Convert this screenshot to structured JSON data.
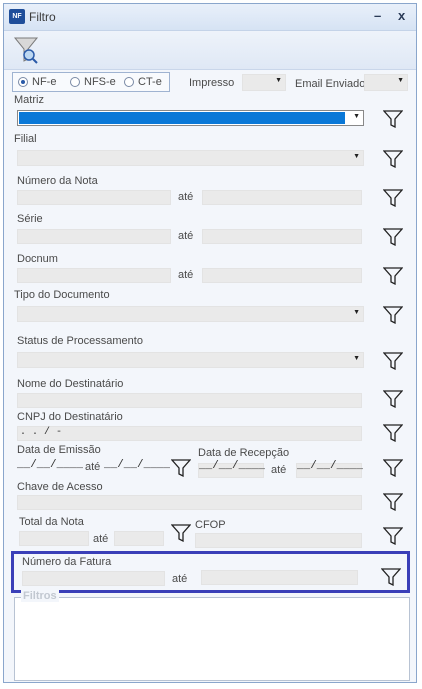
{
  "window": {
    "title": "Filtro",
    "icon_text": "NF",
    "minimize": "–",
    "close": "x"
  },
  "doc_types": {
    "nfe": "NF-e",
    "nfse": "NFS-e",
    "cte": "CT-e",
    "selected": "NF-e"
  },
  "impresso": {
    "label": "Impresso",
    "value": ""
  },
  "email_enviado": {
    "label": "Email Enviado",
    "value": ""
  },
  "matriz": {
    "label": "Matriz",
    "value": ""
  },
  "filial": {
    "label": "Filial",
    "value": ""
  },
  "numero_nota": {
    "label": "Número da Nota",
    "ate": "até"
  },
  "serie": {
    "label": "Série",
    "ate": "até"
  },
  "docnum": {
    "label": "Docnum",
    "ate": "até"
  },
  "tipo_documento": {
    "label": "Tipo do Documento"
  },
  "status_processamento": {
    "label": "Status de Processamento"
  },
  "nome_destinatario": {
    "label": "Nome do Destinatário"
  },
  "cnpj_destinatario": {
    "label": "CNPJ do Destinatário",
    "mask": " .  .  /  -"
  },
  "data_emissao": {
    "label": "Data de Emissão",
    "mask": "__/__/____",
    "ate": "até"
  },
  "data_recepcao": {
    "label": "Data de Recepção",
    "mask": "__/__/____",
    "ate": "até"
  },
  "chave_acesso": {
    "label": "Chave de Acesso"
  },
  "total_nota": {
    "label": "Total da Nota",
    "ate": "até"
  },
  "cfop": {
    "label": "CFOP"
  },
  "numero_fatura": {
    "label": "Número da Fatura",
    "ate": "até"
  },
  "filtros": {
    "label": "Filtros"
  },
  "colors": {
    "accent": "#0a78d7",
    "highlight": "#3a3fb8"
  },
  "icons": [
    "filter-search-icon",
    "filter-icon",
    "combo-arrow-icon"
  ]
}
